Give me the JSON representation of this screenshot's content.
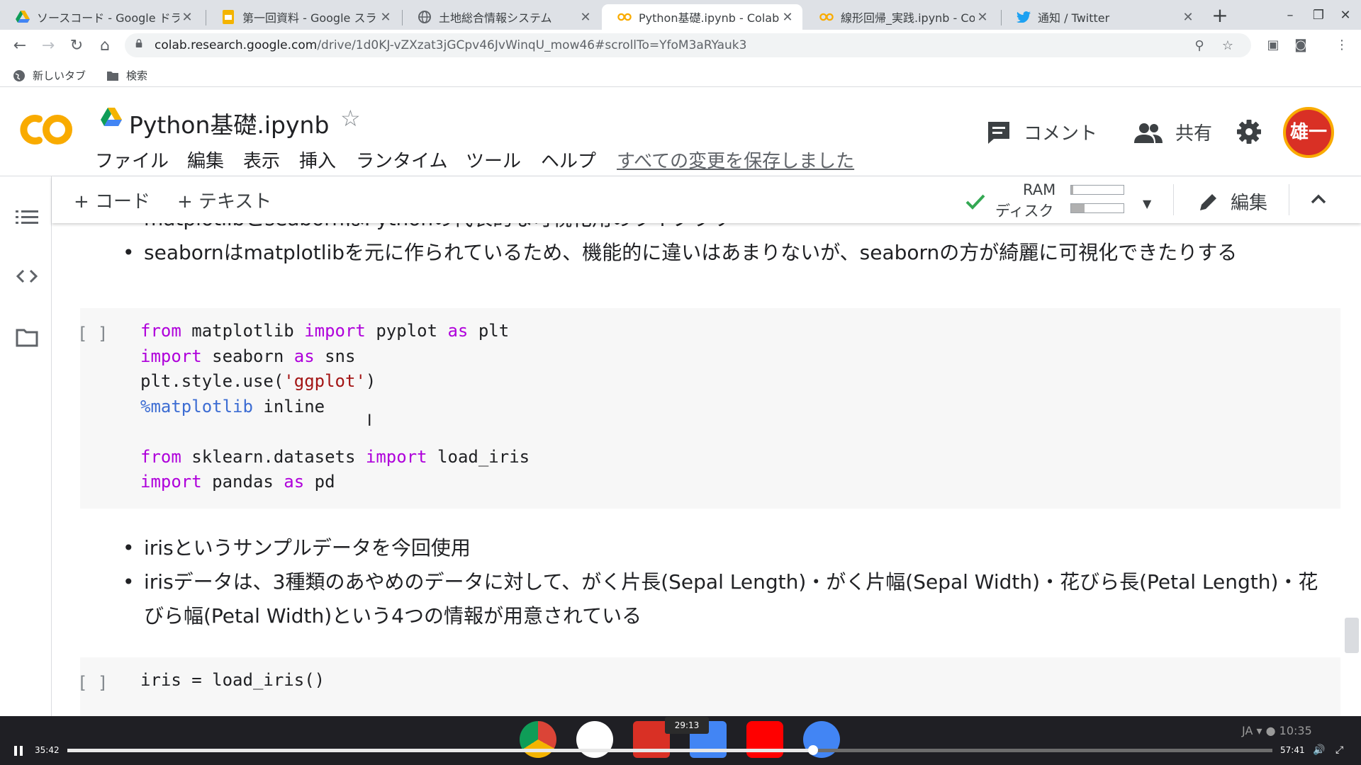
{
  "browser": {
    "tabs": [
      {
        "label": "ソースコード - Google ドラ",
        "icon": "google-drive-icon"
      },
      {
        "label": "第一回資料 - Google スライ",
        "icon": "google-slides-icon"
      },
      {
        "label": "土地総合情報システム",
        "icon": "globe-icon"
      },
      {
        "label": "Python基礎.ipynb - Colabor",
        "icon": "colab-icon",
        "active": true
      },
      {
        "label": "線形回帰_実践.ipynb - Colab",
        "icon": "colab-icon"
      },
      {
        "label": "通知 / Twitter",
        "icon": "twitter-icon"
      }
    ],
    "url_host": "colab.research.google.com",
    "url_path": "/drive/1d0KJ-vZXzat3jGCpv46JvWinqU_mow46#scrollTo=YfoM3aRYauk3",
    "bookmarks": [
      "新しいタブ",
      "検索"
    ]
  },
  "colab": {
    "title": "Python基礎.ipynb",
    "menu": [
      "ファイル",
      "編集",
      "表示",
      "挿入",
      "ランタイム",
      "ツール",
      "ヘルプ"
    ],
    "saved_status": "すべての変更を保存しました",
    "comment_label": "コメント",
    "share_label": "共有",
    "avatar_text": "雄一",
    "add_code": "+ コード",
    "add_text": "+ テキスト",
    "ram_label": "RAM",
    "disk_label": "ディスク",
    "ram_usage": 0.04,
    "disk_usage": 0.25,
    "edit_label": "編集"
  },
  "notebook": {
    "bullets_top": [
      "matplotlibとseabornはPythonの代表的な可視化用のライブラリ",
      "seabornはmatplotlibを元に作られているため、機能的に違いはあまりないが、seabornの方が綺麗に可視化できたりする"
    ],
    "cell1_bracket": "[ ]",
    "bullets_mid": [
      "irisというサンプルデータを今回使用",
      "irisデータは、3種類のあやめのデータに対して、がく片長(Sepal Length)・がく片幅(Sepal Width)・花びら長(Petal Length)・花びら幅(Petal Width)という4つの情報が用意されている"
    ],
    "cell2_bracket": "[ ]",
    "cell2_code": "iris = load_iris()"
  },
  "video": {
    "current_time": "35:42",
    "total_time": "57:41",
    "hover_time": "29:13",
    "progress": 0.619
  }
}
